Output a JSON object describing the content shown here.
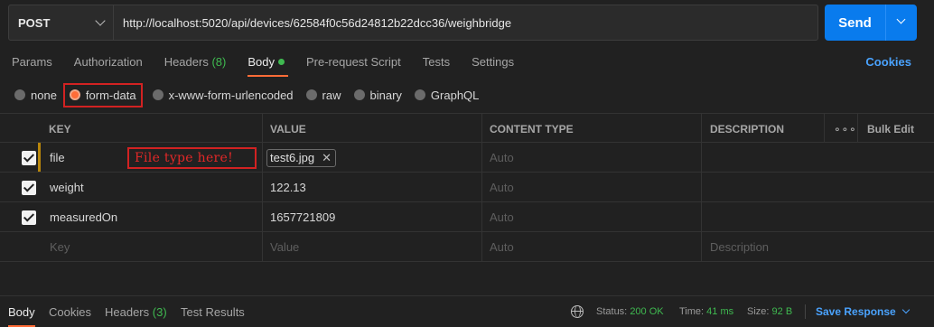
{
  "request": {
    "method": "POST",
    "url": "http://localhost:5020/api/devices/62584f0c56d24812b22dcc36/weighbridge",
    "send_label": "Send"
  },
  "tabs": [
    {
      "label": "Params"
    },
    {
      "label": "Authorization"
    },
    {
      "label": "Headers",
      "count": "(8)"
    },
    {
      "label": "Body",
      "active": true
    },
    {
      "label": "Pre-request Script"
    },
    {
      "label": "Tests"
    },
    {
      "label": "Settings"
    }
  ],
  "cookies_link": "Cookies",
  "body_types": [
    "none",
    "form-data",
    "x-www-form-urlencoded",
    "raw",
    "binary",
    "GraphQL"
  ],
  "selected_body_type": "form-data",
  "table": {
    "headers": {
      "key": "KEY",
      "value": "VALUE",
      "content_type": "CONTENT TYPE",
      "description": "DESCRIPTION",
      "more": "∘∘∘",
      "bulk": "Bulk Edit"
    },
    "rows": [
      {
        "key": "file",
        "value": "test6.jpg",
        "content_type": "Auto",
        "checked": true,
        "is_file": true
      },
      {
        "key": "weight",
        "value": "122.13",
        "content_type": "Auto",
        "checked": true
      },
      {
        "key": "measuredOn",
        "value": "1657721809",
        "content_type": "Auto",
        "checked": true
      }
    ],
    "placeholder": {
      "key": "Key",
      "value": "Value",
      "content_type": "Auto",
      "description": "Description"
    }
  },
  "annotation": "File type here!",
  "response_tabs": [
    {
      "label": "Body",
      "active": true
    },
    {
      "label": "Cookies"
    },
    {
      "label": "Headers",
      "count": "(3)"
    },
    {
      "label": "Test Results"
    }
  ],
  "status": {
    "status_label": "Status:",
    "status_value": "200 OK",
    "time_label": "Time:",
    "time_value": "41 ms",
    "size_label": "Size:",
    "size_value": "92 B"
  },
  "save_response": "Save Response",
  "colors": {
    "accent": "#ff6c37",
    "send": "#097bed",
    "link": "#4aa3ff",
    "success": "#3fb950",
    "annotation": "#d22222"
  }
}
